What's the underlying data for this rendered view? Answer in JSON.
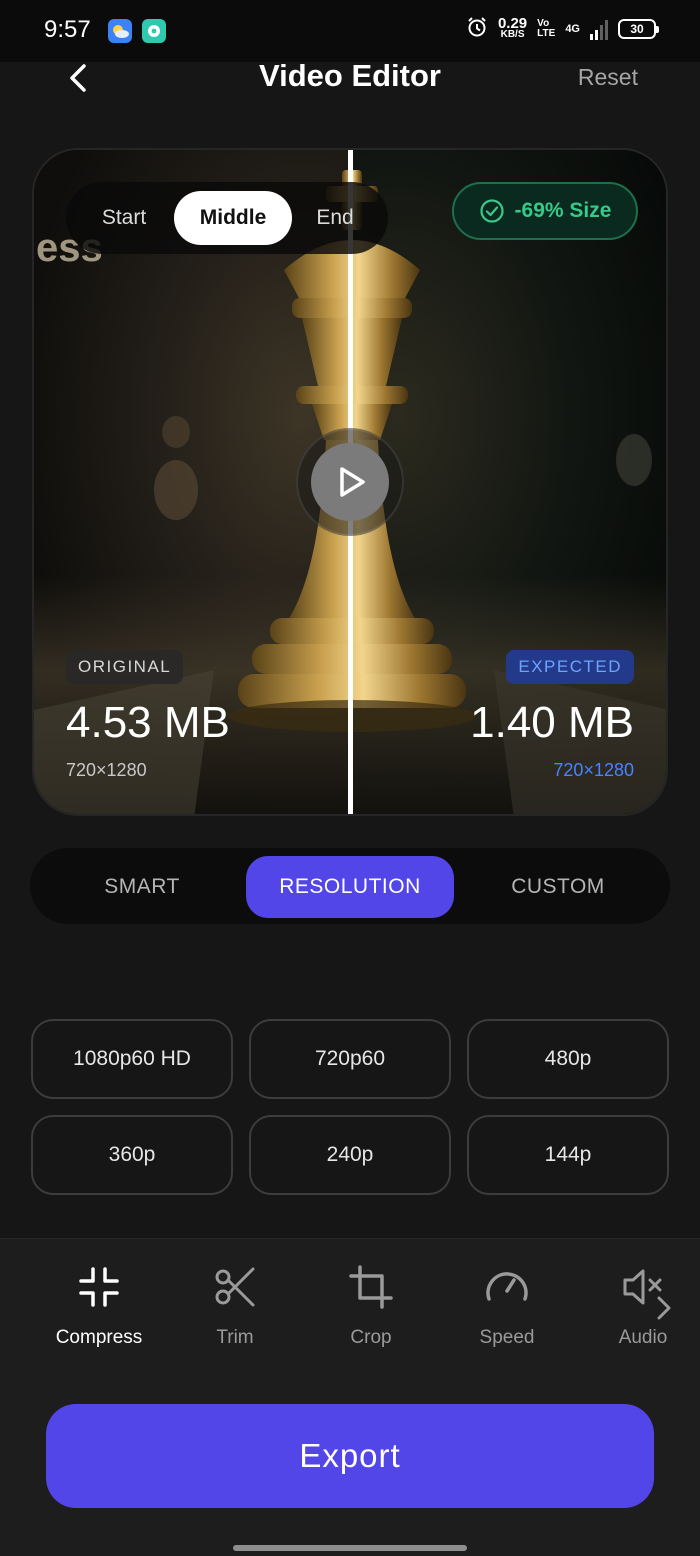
{
  "status_bar": {
    "time": "9:57",
    "net_speed_value": "0.29",
    "net_speed_unit": "KB/S",
    "volte_top": "Vo",
    "volte_bottom": "LTE",
    "network": "4G",
    "battery": "30"
  },
  "header": {
    "title": "Video Editor",
    "reset_label": "Reset"
  },
  "preview": {
    "watermark_text": "ess",
    "position_options": [
      "Start",
      "Middle",
      "End"
    ],
    "position_selected": "Middle",
    "size_badge": "-69% Size",
    "original": {
      "tag": "ORIGINAL",
      "size": "4.53 MB",
      "resolution": "720×1280"
    },
    "expected": {
      "tag": "EXPECTED",
      "size": "1.40 MB",
      "resolution": "720×1280"
    }
  },
  "mode_tabs": {
    "items": [
      "SMART",
      "RESOLUTION",
      "CUSTOM"
    ],
    "selected": "RESOLUTION"
  },
  "resolutions": [
    "1080p60 HD",
    "720p60",
    "480p",
    "360p",
    "240p",
    "144p"
  ],
  "tools": {
    "items": [
      "Compress",
      "Trim",
      "Crop",
      "Speed",
      "Audio"
    ],
    "selected": "Compress"
  },
  "export_label": "Export",
  "colors": {
    "accent": "#5346e8",
    "badge_green": "#38c98a",
    "expected_blue": "#4a82ff"
  }
}
